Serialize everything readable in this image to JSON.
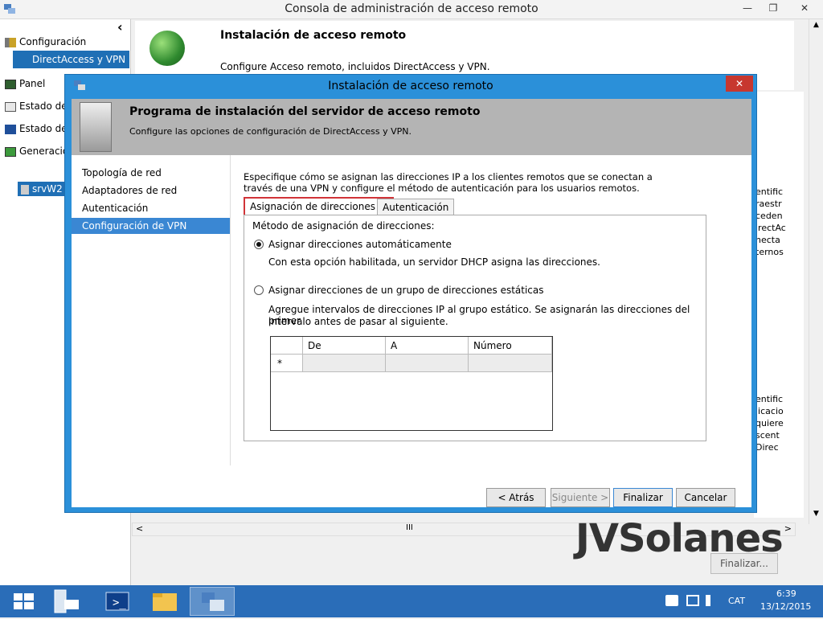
{
  "main_window": {
    "title": "Consola de administración de acceso remoto",
    "controls": {
      "minimize": "—",
      "maximize": "❐",
      "close": "✕"
    }
  },
  "left_pane": {
    "collapse": "‹",
    "items": [
      {
        "label": "Configuración",
        "icon": "wrench-icon"
      },
      {
        "label": "DirectAccess y VPN",
        "selected": true
      },
      {
        "label": "Panel",
        "icon": "dashboard-icon"
      },
      {
        "label": "Estado de",
        "icon": "status-icon"
      },
      {
        "label": "Estado de",
        "icon": "monitor-icon"
      },
      {
        "label": "Generació",
        "icon": "report-icon"
      },
      {
        "label": "srvW2",
        "icon": "server-icon"
      }
    ]
  },
  "background_panel": {
    "title": "Instalación de acceso remoto",
    "subtitle": "Configure Acceso remoto, incluidos DirectAccess y VPN.",
    "right_snippets": [
      "entific",
      "raestr",
      "ceden",
      "irectAc",
      "necta",
      "ternos",
      "entific",
      "licacio",
      "quiere",
      "scent",
      "Direc"
    ],
    "finish_button": "Finalizar...",
    "scroll_up": "▲",
    "scroll_down": "▼",
    "hscroll_left": "<",
    "hscroll_right": ">",
    "hscroll_grip": "III"
  },
  "watermark": {
    "text": "JVSolanes"
  },
  "dialog": {
    "title": "Instalación de acceso remoto",
    "close": "✕",
    "header": {
      "title": "Programa de instalación del servidor de acceso remoto",
      "subtitle": "Configure las opciones de configuración de DirectAccess y VPN."
    },
    "nav": [
      {
        "label": "Topología de red"
      },
      {
        "label": "Adaptadores de red"
      },
      {
        "label": "Autenticación"
      },
      {
        "label": "Configuración de VPN",
        "selected": true
      }
    ],
    "intro_line1": "Especifique cómo se asignan las direcciones IP a los clientes remotos que se conectan a",
    "intro_line2": "través de una VPN y configure el método de autenticación para los usuarios remotos.",
    "tabs": [
      {
        "label": "Asignación de direcciones IP",
        "active": true
      },
      {
        "label": "Autenticación",
        "active": false
      }
    ],
    "method_label": "Método de asignación de direcciones:",
    "option_auto": {
      "label": "Asignar direcciones automáticamente",
      "description": "Con esta opción habilitada, un servidor DHCP asigna las direcciones.",
      "checked": true
    },
    "option_static": {
      "label": "Asignar direcciones de un grupo de direcciones estáticas",
      "description_line1": "Agregue intervalos de direcciones IP al grupo estático. Se asignarán las direcciones del primer",
      "description_line2": "intervalo antes de pasar al siguiente.",
      "checked": false
    },
    "grid": {
      "columns": [
        "De",
        "A",
        "Número"
      ],
      "new_row_marker": "*"
    },
    "buttons": {
      "back": "< Atrás",
      "next": "Siguiente >",
      "finish": "Finalizar",
      "cancel": "Cancelar"
    }
  },
  "taskbar": {
    "apps": [
      "start-icon",
      "server-manager-icon",
      "powershell-icon",
      "file-explorer-icon",
      "remote-access-icon"
    ],
    "language": "CAT",
    "time": "6:39",
    "date": "13/12/2015"
  }
}
